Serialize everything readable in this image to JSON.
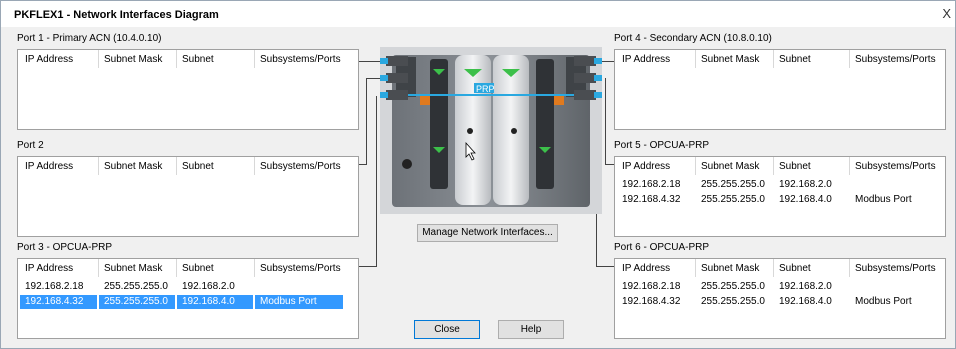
{
  "window": {
    "title": "PKFLEX1 - Network Interfaces Diagram",
    "close_glyph": "X"
  },
  "columns": [
    "IP Address",
    "Subnet Mask",
    "Subnet",
    "Subsystems/Ports"
  ],
  "ports": [
    {
      "label": "Port 1  - Primary ACN (10.4.0.10)",
      "rows": []
    },
    {
      "label": "Port 2",
      "rows": []
    },
    {
      "label": "Port 3  - OPCUA-PRP",
      "rows": [
        {
          "ip": "192.168.2.18",
          "mask": "255.255.255.0",
          "subnet": "192.168.2.0",
          "sub": ""
        },
        {
          "ip": "192.168.4.32",
          "mask": "255.255.255.0",
          "subnet": "192.168.4.0",
          "sub": "Modbus Port",
          "selected": true
        }
      ]
    },
    {
      "label": "Port 4  - Secondary ACN (10.8.0.10)",
      "rows": []
    },
    {
      "label": "Port 5  - OPCUA-PRP",
      "rows": [
        {
          "ip": "192.168.2.18",
          "mask": "255.255.255.0",
          "subnet": "192.168.2.0",
          "sub": ""
        },
        {
          "ip": "192.168.4.32",
          "mask": "255.255.255.0",
          "subnet": "192.168.4.0",
          "sub": "Modbus Port"
        }
      ]
    },
    {
      "label": "Port 6  - OPCUA-PRP",
      "rows": [
        {
          "ip": "192.168.2.18",
          "mask": "255.255.255.0",
          "subnet": "192.168.2.0",
          "sub": ""
        },
        {
          "ip": "192.168.4.32",
          "mask": "255.255.255.0",
          "subnet": "192.168.4.0",
          "sub": "Modbus Port"
        }
      ]
    }
  ],
  "device": {
    "prp_label": "PRP"
  },
  "buttons": {
    "manage": "Manage Network Interfaces...",
    "close": "Close",
    "help": "Help"
  },
  "colors": {
    "accent": "#2aa8e0",
    "selection": "#3399ff",
    "led": "#3cc04a"
  }
}
